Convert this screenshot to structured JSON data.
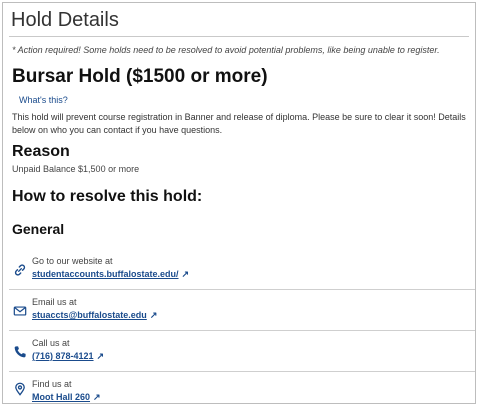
{
  "page_title": "Hold Details",
  "notice": "* Action required! Some holds need to be resolved to avoid potential problems, like being unable to register.",
  "hold": {
    "title": "Bursar Hold ($1500 or more)",
    "whats_this": "What's this?",
    "description": "This hold will prevent course registration in Banner and release of diploma. Please be sure to clear it soon! Details below on who you can contact if you have questions."
  },
  "reason": {
    "heading": "Reason",
    "text": "Unpaid Balance $1,500 or more"
  },
  "resolve": {
    "heading": "How to resolve this hold:",
    "subheading": "General"
  },
  "contacts": [
    {
      "icon": "link-icon",
      "label": "Go to our website at",
      "link": "studentaccounts.buffalostate.edu/"
    },
    {
      "icon": "mail-icon",
      "label": "Email us at",
      "link": "stuaccts@buffalostate.edu"
    },
    {
      "icon": "phone-icon",
      "label": "Call us at",
      "link": "(716) 878-4121"
    },
    {
      "icon": "location-icon",
      "label": "Find us at",
      "link": "Moot Hall 260"
    }
  ],
  "colors": {
    "link": "#1a4b8c",
    "divider": "#cfcfcf"
  }
}
